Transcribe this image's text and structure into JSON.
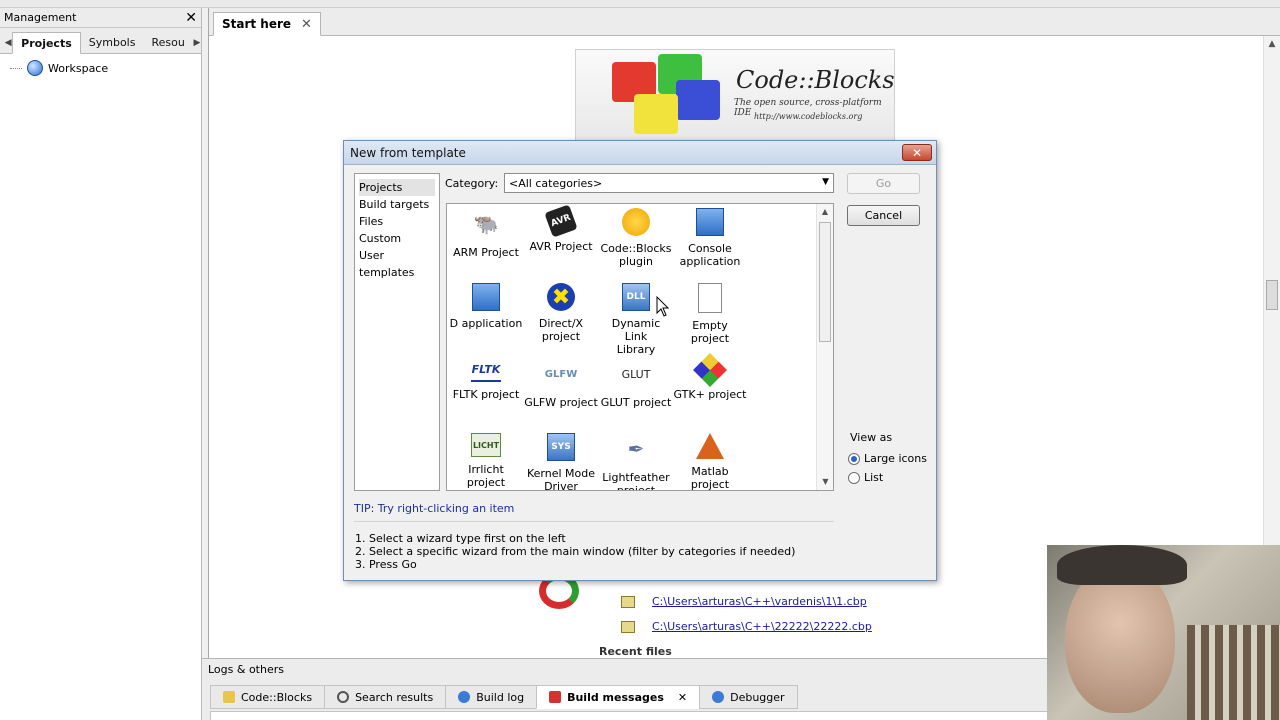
{
  "management": {
    "title": "Management",
    "close": "✕",
    "tabs": [
      "Projects",
      "Symbols",
      "Resou"
    ],
    "tree_root": "Workspace"
  },
  "editor": {
    "tab_label": "Start here",
    "tab_close": "✕"
  },
  "banner": {
    "title": "Code::Blocks",
    "subtitle": "The open source, cross-platform IDE",
    "url": "http://www.codeblocks.org"
  },
  "recent_projects": [
    "C:\\Users\\arturas\\C++\\vardenis\\1\\1.cbp",
    "C:\\Users\\arturas\\C++\\22222\\22222.cbp"
  ],
  "recent_files_heading": "Recent files",
  "logs": {
    "title": "Logs & others",
    "tabs": [
      "Code::Blocks",
      "Search results",
      "Build log",
      "Build messages",
      "Debugger"
    ],
    "active_tab_close": "✕"
  },
  "dialog": {
    "title": "New from template",
    "close": "✕",
    "left_items": [
      "Projects",
      "Build targets",
      "Files",
      "Custom",
      "User templates"
    ],
    "category_label": "Category:",
    "category_value": "<All categories>",
    "templates": [
      {
        "line1": "ARM Project",
        "line2": ""
      },
      {
        "line1": "AVR Project",
        "line2": ""
      },
      {
        "line1": "Code::Blocks",
        "line2": "plugin"
      },
      {
        "line1": "Console",
        "line2": "application"
      },
      {
        "line1": "D application",
        "line2": ""
      },
      {
        "line1": "Direct/X",
        "line2": "project"
      },
      {
        "line1": "Dynamic Link",
        "line2": "Library"
      },
      {
        "line1": "Empty project",
        "line2": ""
      },
      {
        "line1": "FLTK project",
        "line2": ""
      },
      {
        "line1": "GLFW project",
        "line2": ""
      },
      {
        "line1": "GLUT project",
        "line2": ""
      },
      {
        "line1": "GTK+ project",
        "line2": ""
      },
      {
        "line1": "Irrlicht project",
        "line2": ""
      },
      {
        "line1": "Kernel Mode",
        "line2": "Driver"
      },
      {
        "line1": "Lightfeather",
        "line2": "project"
      },
      {
        "line1": "Matlab project",
        "line2": ""
      }
    ],
    "icon_labels": {
      "avr": "AVR",
      "dll": "DLL",
      "fltk": "FLTK",
      "glfw": "GLFW",
      "glut": "GLUT",
      "irrlicht": "LICHT",
      "sys": "SYS"
    },
    "go": "Go",
    "cancel": "Cancel",
    "view_as_label": "View as",
    "view_options": [
      "Large icons",
      "List"
    ],
    "tip": "TIP: Try right-clicking an item",
    "steps": [
      "1. Select a wizard type first on the left",
      "2. Select a specific wizard from the main window (filter by categories if needed)",
      "3. Press Go"
    ]
  },
  "colors": {
    "link": "#1a1aa6",
    "tip": "#1a2fa0",
    "dialog_border": "#6f8fb7",
    "close_red": "#c44a2f"
  }
}
